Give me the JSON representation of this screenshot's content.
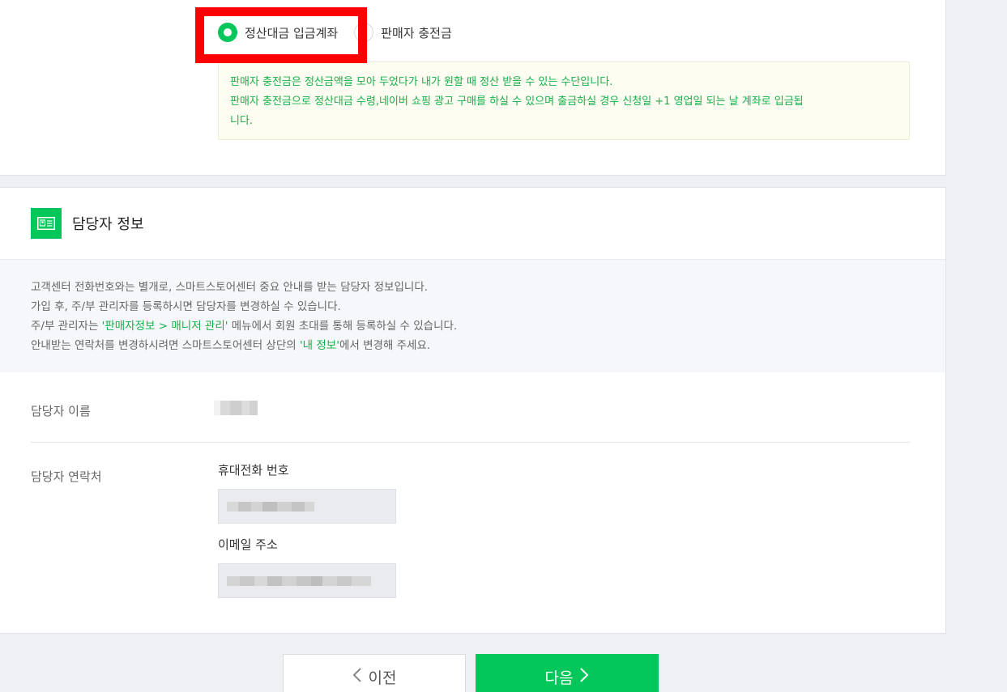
{
  "settlement": {
    "options": [
      {
        "label": "정산대금 입금계좌",
        "checked": true
      },
      {
        "label": "판매자 충전금",
        "checked": false
      }
    ],
    "notice_lines": [
      "판매자 충전금은 정산금액을 모아 두었다가 내가 원할 때 정산 받을 수 있는 수단입니다.",
      "판매자 충전금으로 정산대금 수령,네이버 쇼핑 광고 구매를 하실 수 있으며 출금하실 경우 신청일 +1 영업일 되는 날 계좌로 입금됩",
      "니다."
    ]
  },
  "manager": {
    "title": "담당자 정보",
    "info_lines": {
      "line1": "고객센터 전화번호와는 별개로, 스마트스토어센터 중요 안내를 받는 담당자 정보입니다.",
      "line2": "가입 후, 주/부 관리자를 등록하시면 담당자를 변경하실 수 있습니다.",
      "line3_pre": "주/부 관리자는 ",
      "line3_link": "'판매자정보 > 매니저 관리'",
      "line3_post": " 메뉴에서 회원 초대를 통해 등록하실 수 있습니다.",
      "line4_pre": "안내받는 연락처를 변경하시려면 스마트스토어센터 상단의 ",
      "line4_link": "'내 정보'",
      "line4_post": "에서 변경해 주세요."
    },
    "name_label": "담당자 이름",
    "contact_label": "담당자 연락처",
    "phone_label": "휴대전화 번호",
    "email_label": "이메일 주소"
  },
  "buttons": {
    "prev_label": "이전",
    "next_label": "다음"
  },
  "colors": {
    "accent": "#03c75a",
    "highlight": "#ff0000",
    "notice_text": "#14b04a"
  }
}
